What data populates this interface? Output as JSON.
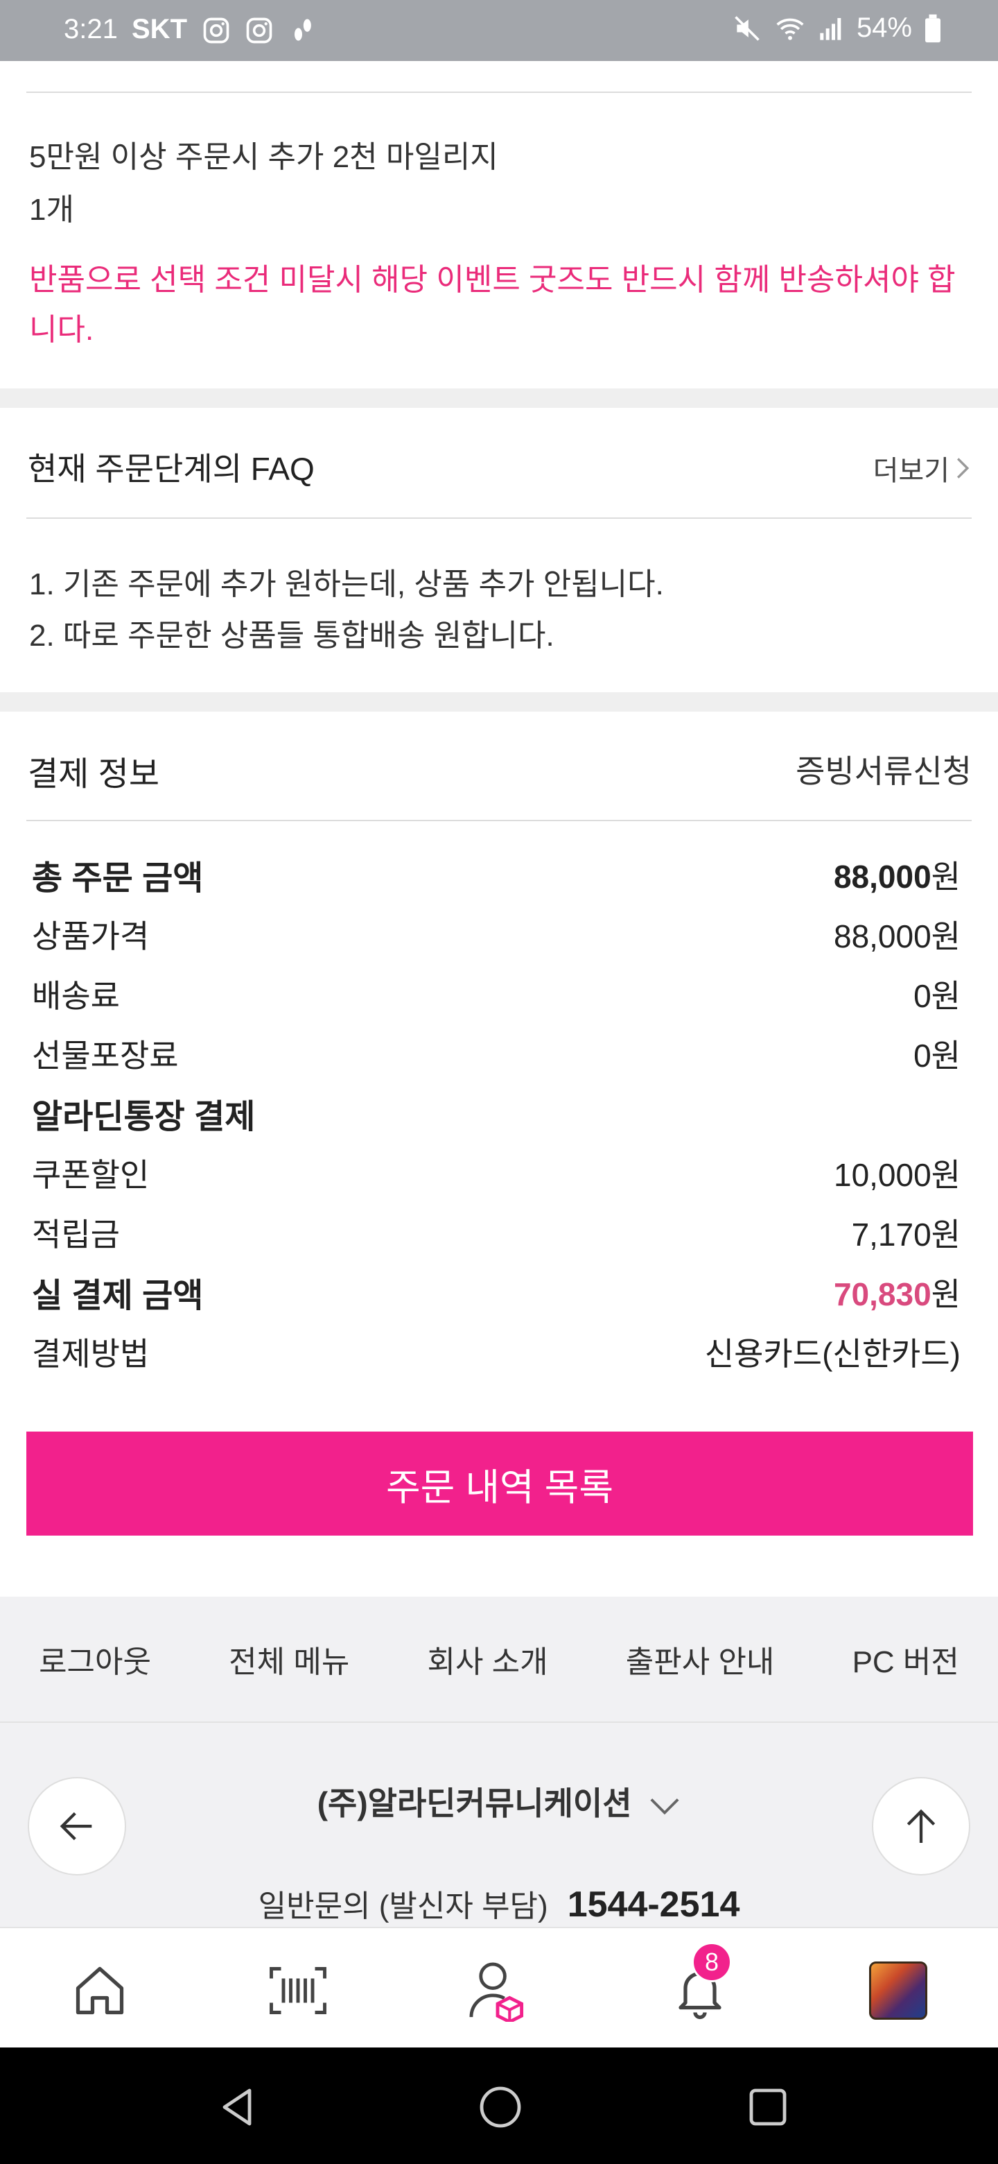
{
  "status_bar": {
    "time": "3:21",
    "carrier": "SKT",
    "battery": "54%"
  },
  "gift": {
    "title": "5만원 이상 주문시 추가 2천 마일리지",
    "quantity": "1개"
  },
  "warning": "반품으로 선택 조건 미달시 해당 이벤트 굿즈도 반드시 함께 반송하셔야 합니다.",
  "faq": {
    "title": "현재 주문단계의 FAQ",
    "more": "더보기",
    "items": [
      "1. 기존 주문에 추가 원하는데, 상품 추가 안됩니다.",
      "2. 따로 주문한 상품들 통합배송 원합니다."
    ]
  },
  "payment": {
    "title": "결제 정보",
    "document_request": "증빙서류신청",
    "total_label": "총 주문 금액",
    "total_value": "88,000",
    "total_unit": "원",
    "product_label": "상품가격",
    "product_value": "88,000원",
    "shipping_label": "배송료",
    "shipping_value": "0원",
    "giftwrap_label": "선물포장료",
    "giftwrap_value": "0원",
    "account_label": "알라딘통장 결제",
    "coupon_label": "쿠폰할인",
    "coupon_value": "10,000원",
    "points_label": "적립금",
    "points_value": "7,170원",
    "final_label": "실 결제 금액",
    "final_value": "70,830",
    "final_unit": "원",
    "method_label": "결제방법",
    "method_value": "신용카드(신한카드)"
  },
  "order_list_button": "주문 내역 목록",
  "footer": {
    "menu": [
      "로그아웃",
      "전체 메뉴",
      "회사 소개",
      "출판사 안내",
      "PC 버전"
    ],
    "company": "(주)알라딘커뮤니케이션",
    "contact_label": "일반문의 (발신자 부담)",
    "contact_phone": "1544-2514"
  },
  "bottom_nav": {
    "notification_count": "8"
  },
  "colors": {
    "accent": "#f2218c",
    "warning": "#ea2b7a",
    "price_highlight": "#d94a7e"
  },
  "icons": [
    "instagram-icon",
    "walk-icon",
    "mute-icon",
    "wifi-icon",
    "signal-icon",
    "battery-icon",
    "chevron-right-icon",
    "back-arrow-icon",
    "up-arrow-icon",
    "home-icon",
    "barcode-icon",
    "my-page-icon",
    "bell-icon",
    "back-triangle-icon",
    "home-circle-icon",
    "recents-square-icon"
  ]
}
